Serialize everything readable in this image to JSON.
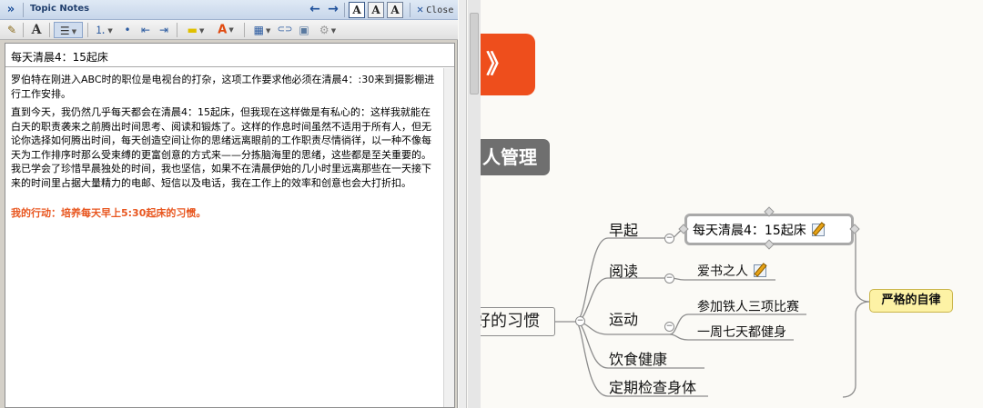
{
  "notes_panel": {
    "collapse_glyph": "»",
    "title": "Topic Notes",
    "nav_back": "←",
    "nav_forward": "→",
    "view_modes": [
      "A",
      "A",
      "A"
    ],
    "close_label": "Close",
    "toolbar": {
      "eraser": "✎",
      "font": "A",
      "align": "☰",
      "numbered_list": "⒈",
      "bullet_list": "•",
      "outdent": "⇤",
      "indent": "⇥",
      "highlight": "▬",
      "font_color": "A",
      "table": "▦",
      "link": "⊂⊃",
      "image": "▣",
      "special": "⚙"
    },
    "note_title": "每天清晨4：15起床",
    "paragraphs": [
      "罗伯特在刚进入ABC时的职位是电视台的打杂，这项工作要求他必须在清晨4：:30来到摄影棚进行工作安排。",
      "直到今天，我仍然几乎每天都会在清晨4：15起床，但我现在这样做是有私心的：这样我就能在白天的职责袭来之前腾出时间思考、阅读和锻炼了。这样的作息时间虽然不适用于所有人，但无论你选择如何腾出时间，每天创造空间让你的思绪远离眼前的工作职责尽情徜徉，以一种不像每天为工作排序时那么受束缚的更富创意的方式来——分拣脑海里的思绪，这些都是至关重要的。我已学会了珍惜早晨独处的时间，我也坚信，如果不在清晨伊始的几小时里远离那些在一天接下来的时间里占据大量精力的电邮、短信以及电话，我在工作上的效率和创意也会大打折扣。"
    ],
    "action_text": "我的行动：培养每天早上5:30起床的习惯。"
  },
  "mindmap": {
    "root_fragment": "》",
    "main_branch_fragment": "人管理",
    "habit_topic_fragment": "好的习惯",
    "branches": [
      {
        "label": "早起"
      },
      {
        "label": "阅读"
      },
      {
        "label": "运动"
      },
      {
        "label": "饮食健康"
      },
      {
        "label": "定期检查身体"
      }
    ],
    "subtopics": {
      "zaoqi": "每天清晨4：15起床",
      "yuedu": "爱书之人",
      "yundong_1": "参加铁人三项比赛",
      "yundong_2": "一周七天都健身"
    },
    "callout": "严格的自律",
    "collapse_glyph": "−",
    "colors": {
      "root": "#ee4e1c",
      "main_branch": "#6f6f6f",
      "callout_fill": "#fdf2a5",
      "action_text": "#e8561f"
    }
  }
}
